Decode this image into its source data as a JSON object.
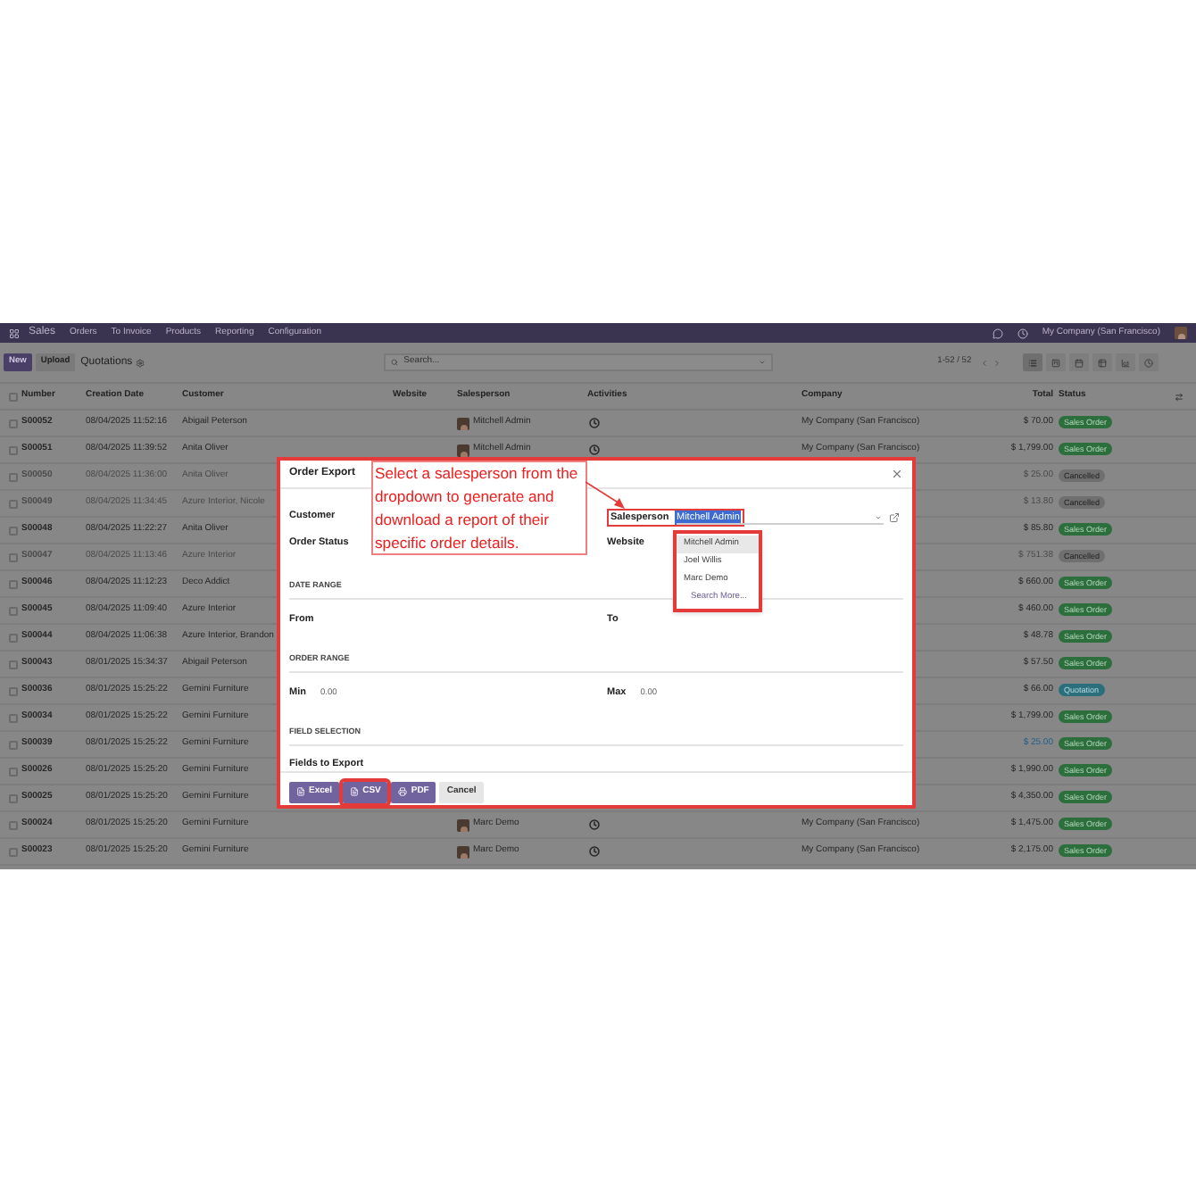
{
  "navbar": {
    "app": "Sales",
    "menu": [
      "Orders",
      "To Invoice",
      "Products",
      "Reporting",
      "Configuration"
    ],
    "company": "My Company (San Francisco)"
  },
  "control_panel": {
    "buttons": [
      {
        "label": "New",
        "kind": "primary"
      },
      {
        "label": "Upload",
        "kind": "secondary"
      }
    ],
    "title": "Quotations",
    "search": {
      "placeholder": "Search..."
    },
    "pager": "1-52 / 52",
    "views": [
      {
        "kind": "list",
        "selected": true
      },
      {
        "kind": "kanban",
        "selected": false
      },
      {
        "kind": "calendar",
        "selected": false
      },
      {
        "kind": "pivot",
        "selected": false
      },
      {
        "kind": "graph",
        "selected": false
      },
      {
        "kind": "activity",
        "selected": false
      }
    ]
  },
  "table": {
    "all_checked": false,
    "columns": [
      "Number",
      "Creation Date",
      "Customer",
      "Website",
      "Salesperson",
      "Activities",
      "Company",
      "Total",
      "Status"
    ],
    "rows": [
      {
        "checked": false,
        "number": "S00052",
        "date": "08/04/2025 11:52:16",
        "customer": "Abigail Peterson",
        "salesperson": "Mitchell Admin",
        "company": "My Company (San Francisco)",
        "total": "$ 70.00",
        "total_highlighted": false,
        "status": {
          "label": "Sales Order",
          "kind": "sale"
        }
      },
      {
        "checked": false,
        "number": "S00051",
        "date": "08/04/2025 11:39:52",
        "customer": "Anita Oliver",
        "salesperson": "Mitchell Admin",
        "company": "My Company (San Francisco)",
        "total": "$ 1,799.00",
        "total_highlighted": false,
        "status": {
          "label": "Sales Order",
          "kind": "sale"
        }
      },
      {
        "checked": false,
        "number": "S00050",
        "date": "08/04/2025 11:36:00",
        "customer": "Anita Oliver",
        "total": "$ 25.00",
        "total_highlighted": false,
        "status": {
          "label": "Cancelled",
          "kind": "cancel"
        }
      },
      {
        "checked": false,
        "number": "S00049",
        "date": "08/04/2025 11:34:45",
        "customer": "Azure Interior, Nicole",
        "total": "$ 13.80",
        "total_highlighted": false,
        "status": {
          "label": "Cancelled",
          "kind": "cancel"
        }
      },
      {
        "checked": false,
        "number": "S00048",
        "date": "08/04/2025 11:22:27",
        "customer": "Anita Oliver",
        "total": "$ 85.80",
        "total_highlighted": false,
        "status": {
          "label": "Sales Order",
          "kind": "sale"
        }
      },
      {
        "checked": false,
        "number": "S00047",
        "date": "08/04/2025 11:13:46",
        "customer": "Azure Interior",
        "total": "$ 751.38",
        "total_highlighted": false,
        "status": {
          "label": "Cancelled",
          "kind": "cancel"
        }
      },
      {
        "checked": false,
        "number": "S00046",
        "date": "08/04/2025 11:12:23",
        "customer": "Deco Addict",
        "total": "$ 660.00",
        "total_highlighted": false,
        "status": {
          "label": "Sales Order",
          "kind": "sale"
        }
      },
      {
        "checked": false,
        "number": "S00045",
        "date": "08/04/2025 11:09:40",
        "customer": "Azure Interior",
        "total": "$ 460.00",
        "total_highlighted": false,
        "status": {
          "label": "Sales Order",
          "kind": "sale"
        }
      },
      {
        "checked": false,
        "number": "S00044",
        "date": "08/04/2025 11:06:38",
        "customer": "Azure Interior, Brandon",
        "total": "$ 48.78",
        "total_highlighted": false,
        "status": {
          "label": "Sales Order",
          "kind": "sale"
        }
      },
      {
        "checked": false,
        "number": "S00043",
        "date": "08/01/2025 15:34:37",
        "customer": "Abigail Peterson",
        "total": "$ 57.50",
        "total_highlighted": false,
        "status": {
          "label": "Sales Order",
          "kind": "sale"
        }
      },
      {
        "checked": false,
        "number": "S00036",
        "date": "08/01/2025 15:25:22",
        "customer": "Gemini Furniture",
        "total": "$ 66.00",
        "total_highlighted": false,
        "status": {
          "label": "Quotation",
          "kind": "quotation"
        }
      },
      {
        "checked": false,
        "number": "S00034",
        "date": "08/01/2025 15:25:22",
        "customer": "Gemini Furniture",
        "total": "$ 1,799.00",
        "total_highlighted": false,
        "status": {
          "label": "Sales Order",
          "kind": "sale"
        }
      },
      {
        "checked": false,
        "number": "S00039",
        "date": "08/01/2025 15:25:22",
        "customer": "Gemini Furniture",
        "total": "$ 25.00",
        "total_highlighted": true,
        "status": {
          "label": "Sales Order",
          "kind": "sale"
        }
      },
      {
        "checked": false,
        "number": "S00026",
        "date": "08/01/2025 15:25:20",
        "customer": "Gemini Furniture",
        "total": "$ 1,990.00",
        "total_highlighted": false,
        "status": {
          "label": "Sales Order",
          "kind": "sale"
        }
      },
      {
        "checked": false,
        "number": "S00025",
        "date": "08/01/2025 15:25:20",
        "customer": "Gemini Furniture",
        "total": "$ 4,350.00",
        "total_highlighted": false,
        "status": {
          "label": "Sales Order",
          "kind": "sale"
        }
      },
      {
        "checked": false,
        "number": "S00024",
        "date": "08/01/2025 15:25:20",
        "customer": "Gemini Furniture",
        "salesperson": "Marc Demo",
        "company": "My Company (San Francisco)",
        "total": "$ 1,475.00",
        "total_highlighted": false,
        "status": {
          "label": "Sales Order",
          "kind": "sale"
        }
      },
      {
        "checked": false,
        "number": "S00023",
        "date": "08/01/2025 15:25:20",
        "customer": "Gemini Furniture",
        "salesperson": "Marc Demo",
        "company": "My Company (San Francisco)",
        "total": "$ 2,175.00",
        "total_highlighted": false,
        "status": {
          "label": "Sales Order",
          "kind": "sale"
        }
      }
    ]
  },
  "dialog": {
    "title": "Order Export",
    "filters": {
      "customer_label": "Customer",
      "status_label": "Order Status",
      "salesperson": {
        "label": "Salesperson",
        "value": "Mitchell Admin"
      },
      "website_label": "Website"
    },
    "dropdown": {
      "options": [
        {
          "label": "Mitchell Admin",
          "selected": true
        },
        {
          "label": "Joel Willis",
          "selected": false
        },
        {
          "label": "Marc Demo",
          "selected": false
        }
      ],
      "more": "Search More..."
    },
    "date_range": {
      "heading": "DATE RANGE",
      "from_label": "From",
      "to_label": "To"
    },
    "order_range": {
      "heading": "ORDER RANGE",
      "min_label": "Min",
      "min_value": "0.00",
      "max_label": "Max",
      "max_value": "0.00"
    },
    "field_selection": {
      "heading": "FIELD SELECTION",
      "label": "Fields to Export"
    },
    "buttons": [
      {
        "label": "Excel",
        "kind": "file",
        "highlighted": false
      },
      {
        "label": "CSV",
        "kind": "file",
        "highlighted": true
      },
      {
        "label": "PDF",
        "kind": "print",
        "highlighted": false
      },
      {
        "label": "Cancel",
        "kind": "secondary",
        "highlighted": false
      }
    ]
  },
  "annotation": {
    "text": "Select a salesperson from the dropdown to generate and download a report of their specific order details."
  }
}
